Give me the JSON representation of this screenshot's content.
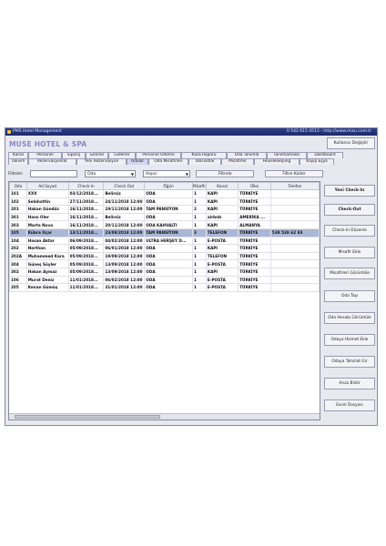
{
  "titlebar": {
    "title": "PMS Hotel Management",
    "contact": "0 542 615 4513 - http://www.misu.com.tr"
  },
  "hotel_name": "MUSE HOTEL & SPA",
  "user_button": "Kullanıcı Değiştir",
  "menu_row1": [
    "Kanal",
    "Personel",
    "Sipariş",
    "Gelirler",
    "Giderler",
    "Personel Ödeme",
    "Kasa Raporu",
    "Oda Tanımla",
    "Tanımlamalar",
    "Dashboard"
  ],
  "menu_row2": [
    "Takvim",
    "Rezervasyonlar",
    "Yeni Rezervasyon",
    "Odalar",
    "Oda Misafirleri",
    "Tahsilatlar",
    "Misafirler",
    "Housekeeping",
    "Kayıp Eşya"
  ],
  "filter": {
    "label": "Filtrele:",
    "value": "",
    "select1": "Oda",
    "select2": "Hepsi",
    "filter_button": "Filtrele",
    "clear_button": "Filtre Kaldır"
  },
  "table": {
    "columns": [
      "Oda",
      "Ad Soyad",
      "Check-In",
      "Check Out",
      "Öğün",
      "Misafir",
      "Kanal",
      "Ülke",
      "Telefon"
    ],
    "rows": [
      [
        "101",
        "XXX",
        "03/12/2018...",
        "Belirsiz",
        "ODA",
        "1",
        "KAPI",
        "TÜRKİYE",
        ""
      ],
      [
        "102",
        "Selahattin",
        "27/11/2018...",
        "24/11/2018 12:00",
        "ODA",
        "1",
        "KAPI",
        "TÜRKİYE",
        ""
      ],
      [
        "201",
        "Hakan Gündüz",
        "16/11/2018...",
        "19/11/2018 12:00",
        "TAM PANSİYON",
        "2",
        "KAPI",
        "TÜRKİYE",
        ""
      ],
      [
        "301",
        "Hans Oler",
        "16/11/2018...",
        "Belirsiz",
        "ODA",
        "1",
        "airbnb",
        "AMERİKA ...",
        ""
      ],
      [
        "303",
        "Marta Nova",
        "16/11/2018...",
        "20/11/2018 12:00",
        "ODA KAHVALTI",
        "1",
        "KAPI",
        "ALMANYA",
        ""
      ],
      [
        "105",
        "Kübra Uçar",
        "13/11/2018...",
        "23/08/2018 12:00",
        "TAM PANSİYON",
        "3",
        "TELEFON",
        "TÜRKİYE",
        "538 528 62 83"
      ],
      [
        "104",
        "Hasan Aktar",
        "06/09/2018...",
        "04/02/2018 12:00",
        "ULTRA HERŞEY D...",
        "1",
        "E-POSTA",
        "TÜRKİYE",
        ""
      ],
      [
        "202",
        "Nerthan",
        "05/09/2018...",
        "06/01/2018 12:00",
        "ODA",
        "1",
        "KAPI",
        "TÜRKİYE",
        ""
      ],
      [
        "202A",
        "Muhammed Kara",
        "05/09/2018...",
        "19/09/2018 12:00",
        "ODA",
        "1",
        "TELEFON",
        "TÜRKİYE",
        ""
      ],
      [
        "304",
        "Güneş Söyler",
        "05/09/2018...",
        "13/09/2018 12:00",
        "ODA",
        "1",
        "E-POSTA",
        "TÜRKİYE",
        ""
      ],
      [
        "302",
        "Hakan Aymaz",
        "05/09/2018...",
        "13/09/2018 12:00",
        "ODA",
        "1",
        "KAPI",
        "TÜRKİYE",
        ""
      ],
      [
        "106",
        "Murat Deniz",
        "11/01/2018...",
        "06/02/2018 12:00",
        "ODA",
        "1",
        "E-POSTA",
        "TÜRKİYE",
        ""
      ],
      [
        "205",
        "Kenan Gümüş",
        "11/01/2018...",
        "31/01/2018 12:00",
        "ODA",
        "1",
        "E-POSTA",
        "TÜRKİYE",
        ""
      ]
    ]
  },
  "side_buttons": [
    "Yeni Check-In",
    "Check-Out",
    "Check-In Düzenle",
    "Misafir Ekle",
    "Misafirleri Görüntüle",
    "Oda Taşı",
    "Oda Hesabı Görüntüle",
    "Odaya Hizmet Ekle",
    "Odaya Tahsilat Gir",
    "Arıza Bildir",
    "Excel Dosyası"
  ]
}
